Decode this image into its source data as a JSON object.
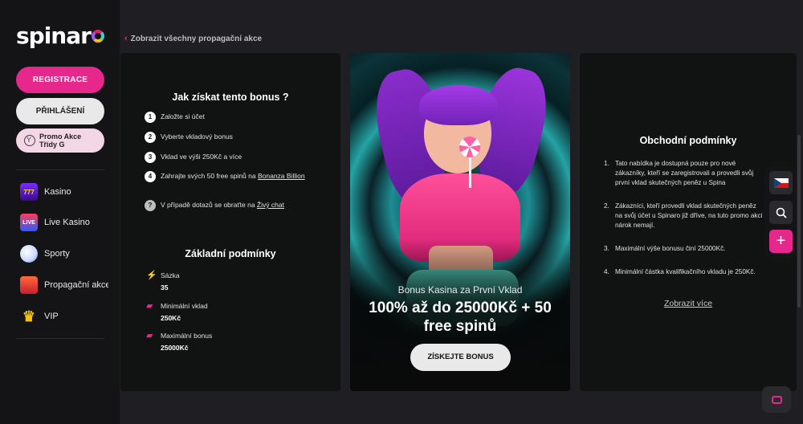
{
  "brand": {
    "logo_text": "spinar",
    "logo_o": "o"
  },
  "sidebar": {
    "register_label": "REGISTRACE",
    "login_label": "PŘIHLÁŠENÍ",
    "promo_label_line1": "Promo Akce",
    "promo_label_line2": "Třídy G",
    "items": [
      {
        "label": "Kasino",
        "icon": "kasino-slot-icon"
      },
      {
        "label": "Live Kasino",
        "icon": "live-kasino-icon"
      },
      {
        "label": "Sporty",
        "icon": "soccer-ball-icon"
      },
      {
        "label": "Propagační akce",
        "icon": "gift-icon"
      },
      {
        "label": "VIP",
        "icon": "crown-icon"
      }
    ]
  },
  "breadcrumb": {
    "label": "Zobrazit všechny propagační akce"
  },
  "how_to": {
    "title": "Jak získat tento bonus ?",
    "steps": [
      {
        "num": "1",
        "text": "Založte si účet"
      },
      {
        "num": "2",
        "text": "Vyberte vkladový bonus"
      },
      {
        "num": "3",
        "text": "Vklad ve výši 250Kč a více"
      },
      {
        "num": "4",
        "text": "Zahrajte svých 50 free spinů na ",
        "link": "Bonanza Billion"
      },
      {
        "num": "?",
        "text": "V případě dotazů se obraťte na ",
        "link": "Živý chat"
      }
    ]
  },
  "basic": {
    "title": "Základní podmínky",
    "rows": [
      {
        "label": "Sázka",
        "value": "35",
        "icon": "lightning-icon"
      },
      {
        "label": "Minimální vklad",
        "value": "250Kč",
        "icon": "wallet-icon"
      },
      {
        "label": "Maximální bonus",
        "value": "25000Kč",
        "icon": "wallet-icon"
      }
    ]
  },
  "hero": {
    "subtitle": "Bonus Kasina za První Vklad",
    "title": "100% až do 25000Kč + 50 free spinů",
    "button": "ZÍSKEJTE BONUS"
  },
  "terms": {
    "title": "Obchodní podmínky",
    "items": [
      {
        "num": "1.",
        "text": "Tato nabídka je dostupná pouze pro nové zákazníky, kteří se zaregistrovali a provedli svůj první vklad skutečných peněz u Spina"
      },
      {
        "num": "2.",
        "text": "Zákazníci, kteří provedli vklad skutečných peněz na svůj účet u Spinaro již dříve, na tuto promo akci nárok nemají."
      },
      {
        "num": "3.",
        "text": "Maximální výše bonusu činí 25000Kč."
      },
      {
        "num": "4.",
        "text": "Minimální částka kvalifikačního vkladu je 250Kč."
      }
    ],
    "more": "Zobrazit více"
  },
  "colors": {
    "accent": "#e6288c",
    "bg": "#1f1f23",
    "card": "#111312"
  }
}
